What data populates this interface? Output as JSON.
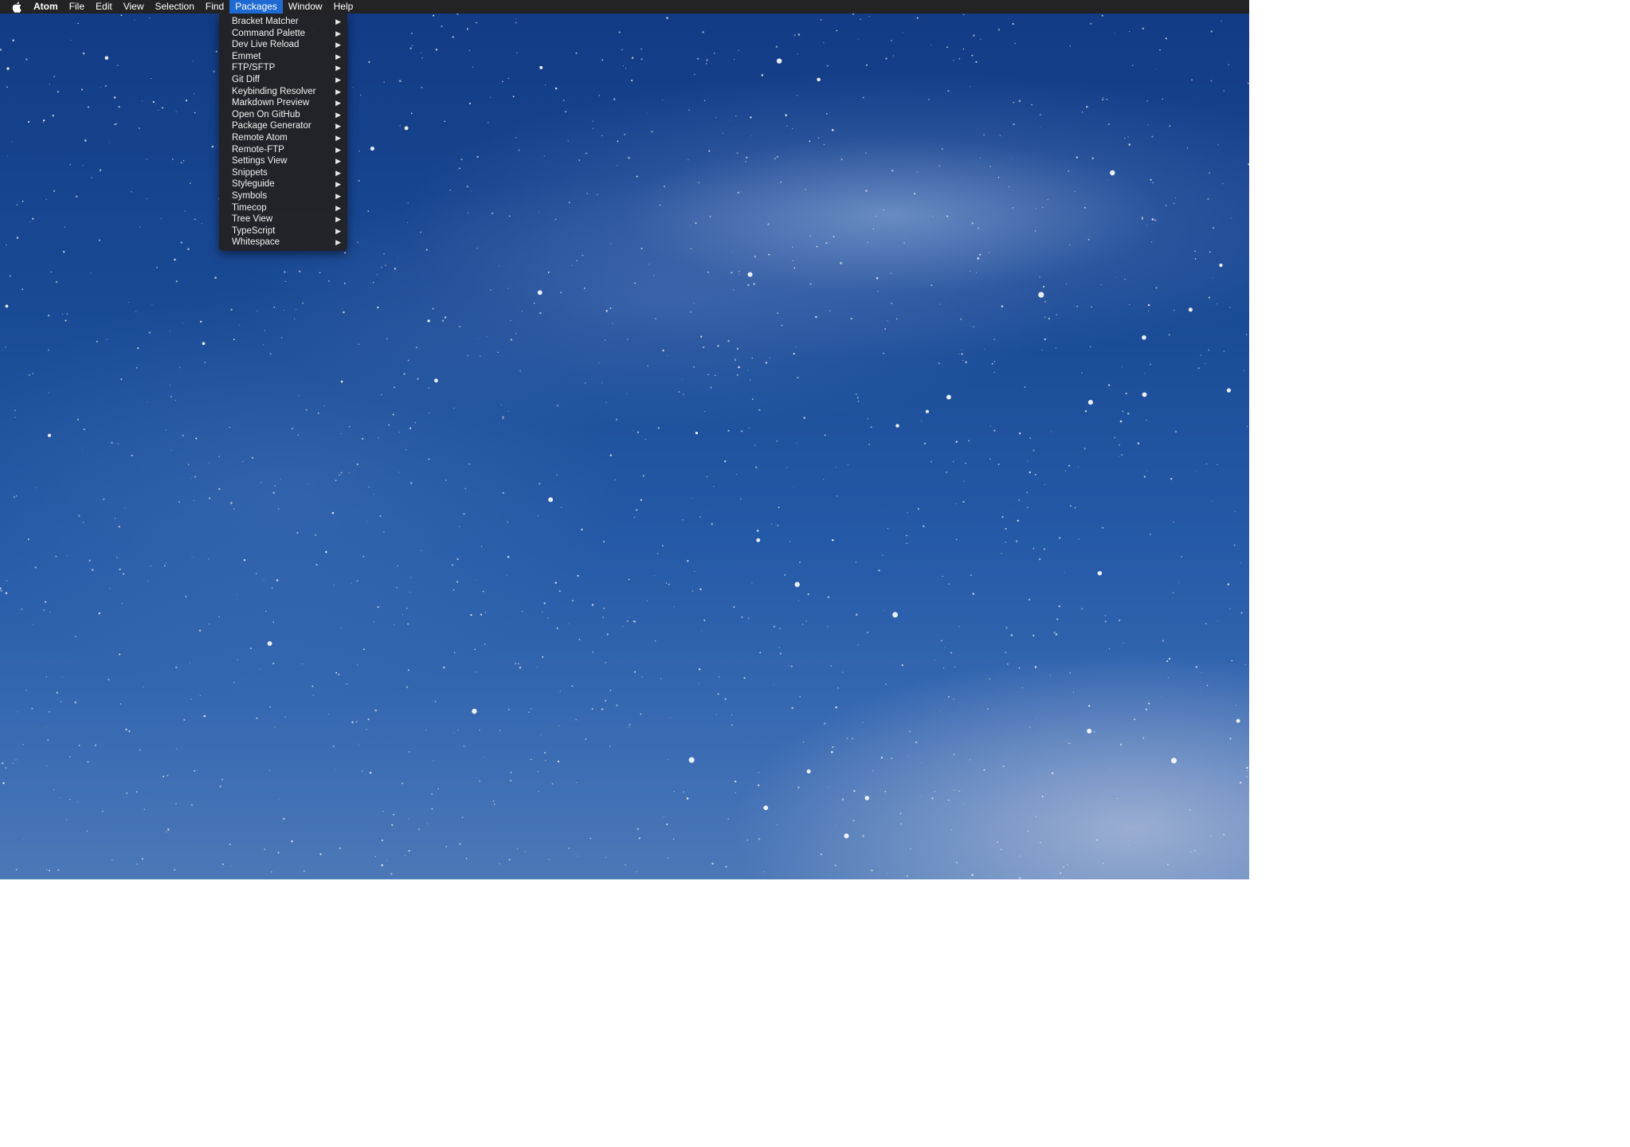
{
  "menubar": {
    "apple_icon": "apple-logo-icon",
    "app_name": "Atom",
    "menus": [
      {
        "label": "File"
      },
      {
        "label": "Edit"
      },
      {
        "label": "View"
      },
      {
        "label": "Selection"
      },
      {
        "label": "Find"
      },
      {
        "label": "Packages",
        "active": true
      },
      {
        "label": "Window"
      },
      {
        "label": "Help"
      }
    ]
  },
  "packages_menu": {
    "submenu_icon": "submenu-arrow-icon",
    "items": [
      {
        "label": "Bracket Matcher"
      },
      {
        "label": "Command Palette"
      },
      {
        "label": "Dev Live Reload"
      },
      {
        "label": "Emmet"
      },
      {
        "label": "FTP/SFTP"
      },
      {
        "label": "Git Diff"
      },
      {
        "label": "Keybinding Resolver"
      },
      {
        "label": "Markdown Preview"
      },
      {
        "label": "Open On GitHub"
      },
      {
        "label": "Package Generator"
      },
      {
        "label": "Remote Atom"
      },
      {
        "label": "Remote-FTP"
      },
      {
        "label": "Settings View"
      },
      {
        "label": "Snippets"
      },
      {
        "label": "Styleguide"
      },
      {
        "label": "Symbols"
      },
      {
        "label": "Timecop"
      },
      {
        "label": "Tree View"
      },
      {
        "label": "TypeScript"
      },
      {
        "label": "Whitespace"
      }
    ]
  },
  "colors": {
    "menubar_bg": "#232325",
    "active_highlight": "#1f6ad2",
    "menu_bg": "#222224",
    "wallpaper_top": "#123b84",
    "wallpaper_bottom": "#4b78b7"
  }
}
